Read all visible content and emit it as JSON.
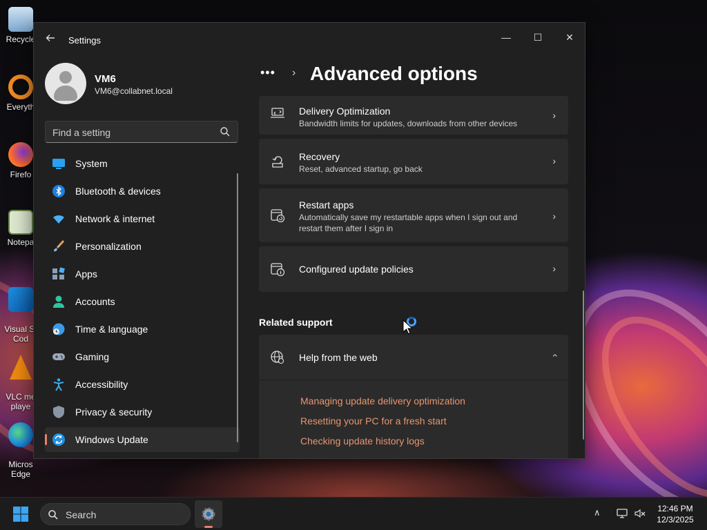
{
  "desktop": {
    "icons": [
      {
        "label": "Recycle",
        "name": "recycle-bin-icon"
      },
      {
        "label": "Everyth",
        "name": "everything-app-icon"
      },
      {
        "label": "Firefo",
        "name": "firefox-icon"
      },
      {
        "label": "Notepa",
        "name": "notepad-icon"
      },
      {
        "label": "Visual St\nCod",
        "name": "vscode-icon"
      },
      {
        "label": "VLC me\nplaye",
        "name": "vlc-icon"
      },
      {
        "label": "Micros\nEdge",
        "name": "edge-icon"
      }
    ]
  },
  "window": {
    "app_title": "Settings",
    "controls": {
      "minimize": "—",
      "maximize": "☐",
      "close": "✕"
    }
  },
  "profile": {
    "name": "VM6",
    "email": "VM6@collabnet.local"
  },
  "search": {
    "placeholder": "Find a setting"
  },
  "nav": {
    "items": [
      {
        "label": "System",
        "icon": "system-icon"
      },
      {
        "label": "Bluetooth & devices",
        "icon": "bluetooth-icon"
      },
      {
        "label": "Network & internet",
        "icon": "wifi-icon"
      },
      {
        "label": "Personalization",
        "icon": "brush-icon"
      },
      {
        "label": "Apps",
        "icon": "apps-icon"
      },
      {
        "label": "Accounts",
        "icon": "person-icon"
      },
      {
        "label": "Time & language",
        "icon": "globe-clock-icon"
      },
      {
        "label": "Gaming",
        "icon": "gamepad-icon"
      },
      {
        "label": "Accessibility",
        "icon": "accessibility-icon"
      },
      {
        "label": "Privacy & security",
        "icon": "shield-icon"
      },
      {
        "label": "Windows Update",
        "icon": "sync-icon"
      }
    ],
    "selected": "Windows Update"
  },
  "main": {
    "breadcrumb_more": "•••",
    "breadcrumb_separator": "›",
    "title": "Advanced options",
    "cards": [
      {
        "title": "Delivery Optimization",
        "description": "Bandwidth limits for updates, downloads from other devices",
        "icon": "delivery-optimization-icon"
      },
      {
        "title": "Recovery",
        "description": "Reset, advanced startup, go back",
        "icon": "recovery-icon"
      },
      {
        "title": "Restart apps",
        "description": "Automatically save my restartable apps when I sign out and restart them after I sign in",
        "icon": "restart-apps-icon"
      },
      {
        "title": "Configured update policies",
        "description": "",
        "icon": "update-policies-icon"
      }
    ],
    "related_support": {
      "heading": "Related support",
      "help_title": "Help from the web",
      "links": [
        "Managing update delivery optimization",
        "Resetting your PC for a fresh start",
        "Checking update history logs"
      ]
    }
  },
  "taskbar": {
    "search_label": "Search",
    "clock_time": "12:46 PM",
    "clock_date": "12/3/2025"
  },
  "colors": {
    "accent": "#e8826a",
    "link": "#e8956f",
    "window_bg": "#202020",
    "card_bg": "#2b2b2b"
  }
}
